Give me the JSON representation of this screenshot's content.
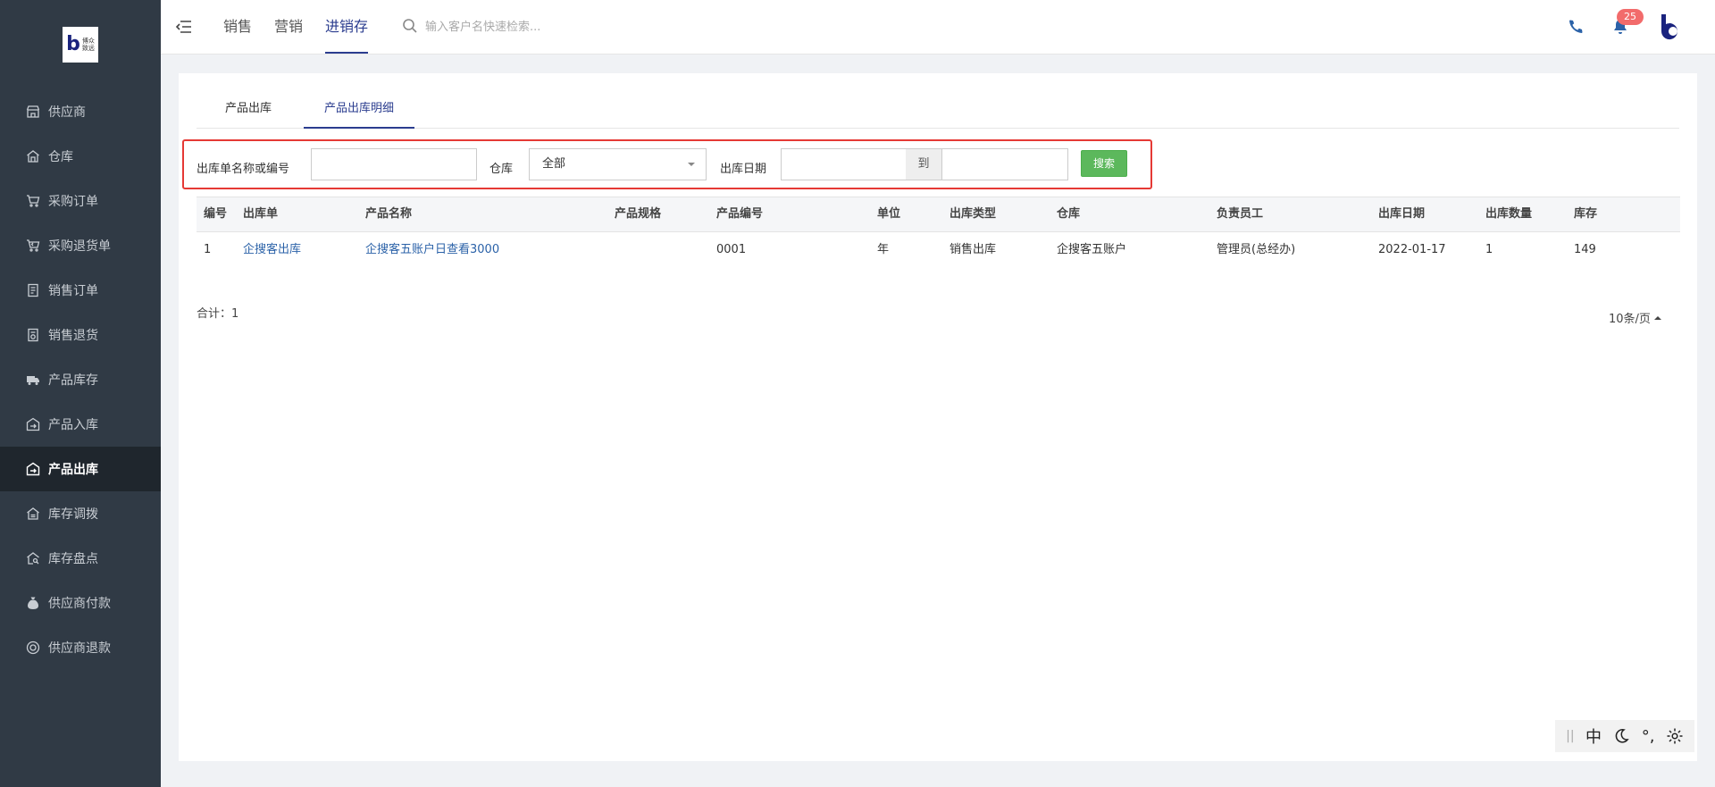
{
  "logo": {
    "line1": "博众",
    "line2": "致远"
  },
  "sidebar": {
    "items": [
      {
        "label": "供应商",
        "icon": "store-icon"
      },
      {
        "label": "仓库",
        "icon": "warehouse-icon"
      },
      {
        "label": "采购订单",
        "icon": "cart-icon"
      },
      {
        "label": "采购退货单",
        "icon": "cart-return-icon"
      },
      {
        "label": "销售订单",
        "icon": "sales-order-icon"
      },
      {
        "label": "销售退货",
        "icon": "sales-return-icon"
      },
      {
        "label": "产品库存",
        "icon": "truck-icon"
      },
      {
        "label": "产品入库",
        "icon": "stock-in-icon"
      },
      {
        "label": "产品出库",
        "icon": "stock-out-icon",
        "active": true
      },
      {
        "label": "库存调拨",
        "icon": "transfer-icon"
      },
      {
        "label": "库存盘点",
        "icon": "inventory-check-icon"
      },
      {
        "label": "供应商付款",
        "icon": "money-bag-icon"
      },
      {
        "label": "供应商退款",
        "icon": "refund-icon"
      }
    ]
  },
  "header": {
    "tabs": [
      {
        "label": "销售"
      },
      {
        "label": "营销"
      },
      {
        "label": "进销存",
        "active": true
      }
    ],
    "search_placeholder": "输入客户名快速检索...",
    "notification_count": "25"
  },
  "subtabs": [
    {
      "label": "产品出库"
    },
    {
      "label": "产品出库明细",
      "active": true
    }
  ],
  "filter": {
    "name_label": "出库单名称或编号",
    "name_value": "",
    "warehouse_label": "仓库",
    "warehouse_value": "全部",
    "date_label": "出库日期",
    "date_from": "",
    "date_to_label": "到",
    "date_to": "",
    "search_button": "搜索"
  },
  "table": {
    "columns": [
      "编号",
      "出库单",
      "产品名称",
      "产品规格",
      "产品编号",
      "单位",
      "出库类型",
      "仓库",
      "负责员工",
      "出库日期",
      "出库数量",
      "库存"
    ],
    "rows": [
      [
        "1",
        "企搜客出库",
        "企搜客五账户日查看3000",
        "",
        "0001",
        "年",
        "销售出库",
        "企搜客五账户",
        "管理员(总经办)",
        "2022-01-17",
        "1",
        "149"
      ]
    ]
  },
  "summary": "合计：1",
  "pager": {
    "page_size": "10条/页"
  },
  "ime": {
    "lang": "中",
    "punct": "°,"
  },
  "colors": {
    "sidebar": "#303a45",
    "accent": "#2b3d8f",
    "link": "#2b62a8",
    "search_btn": "#5cb85c",
    "highlight_border": "#e53935",
    "badge": "#f26b6b"
  }
}
